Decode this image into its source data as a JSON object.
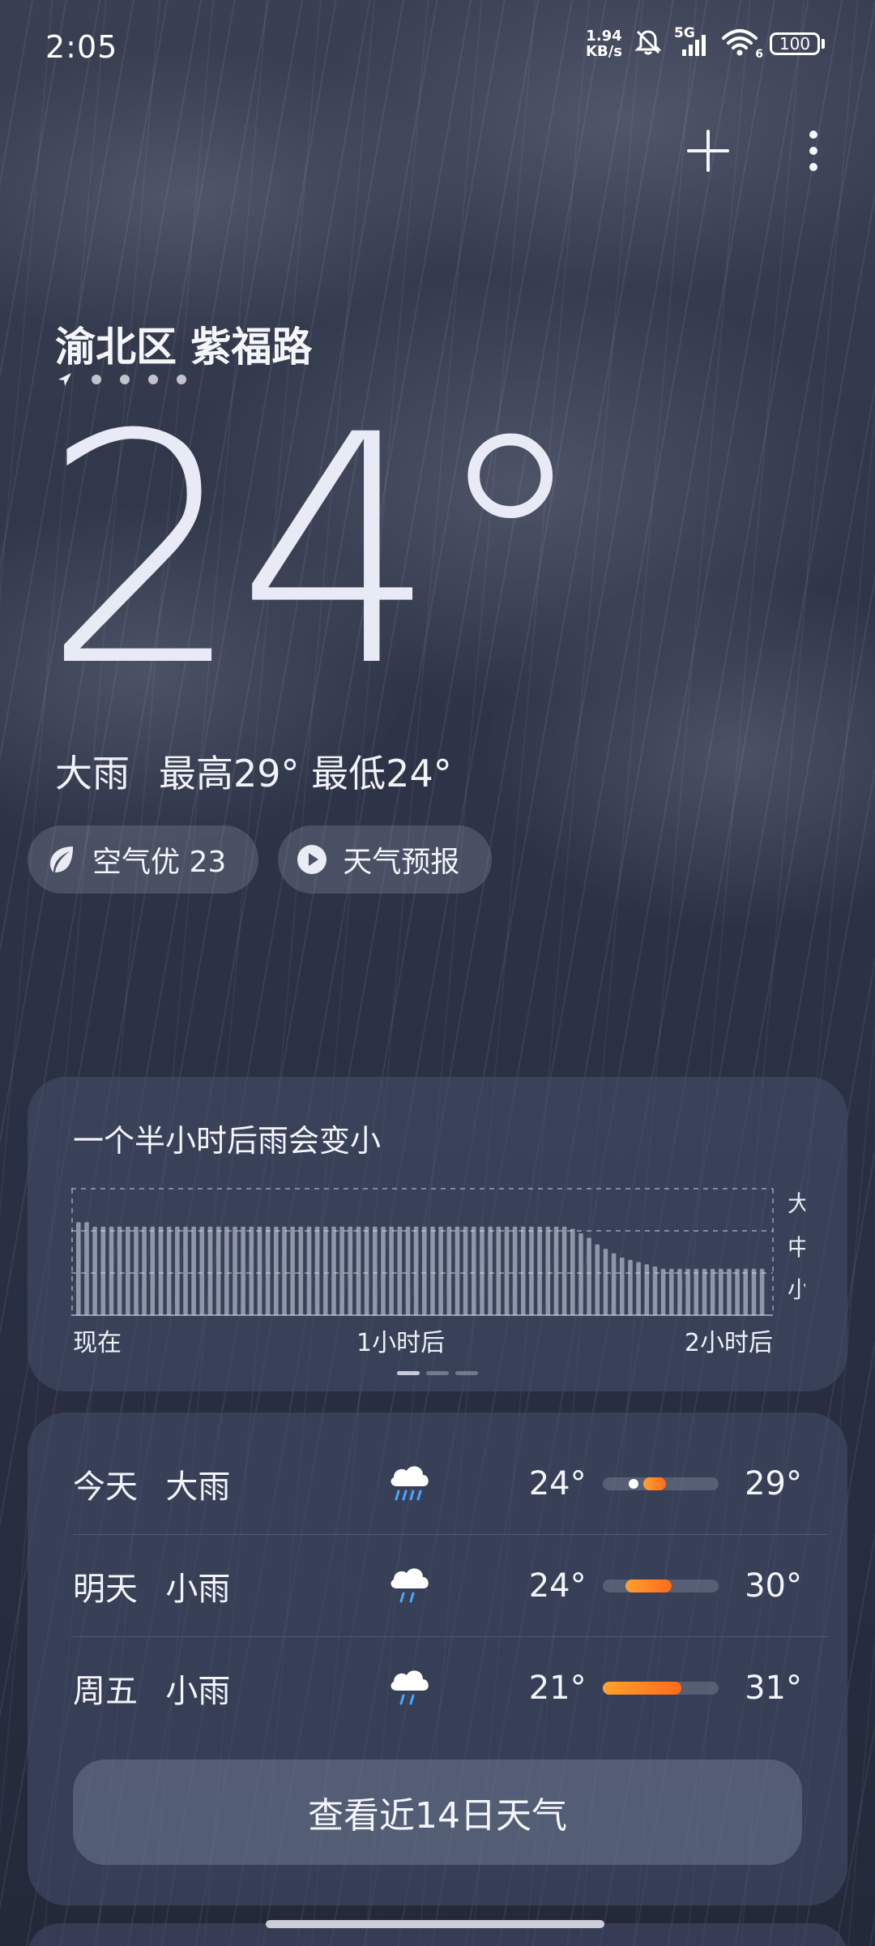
{
  "status_bar": {
    "time": "2:05",
    "net_speed_value": "1.94",
    "net_speed_unit": "KB/s",
    "network_type": "5G",
    "wifi_badge": "6",
    "battery": "100",
    "icons": [
      "mute-bell-icon",
      "signal-icon",
      "wifi-icon",
      "battery-icon"
    ]
  },
  "header": {
    "add_city_icon": "plus-icon",
    "more_icon": "more-vertical-icon"
  },
  "location": {
    "name": "渝北区 紫福路",
    "pages": 5,
    "current_page": 1
  },
  "current": {
    "temperature": "24°",
    "condition": "大雨",
    "high": "最高29°",
    "low": "最低24°"
  },
  "chips": {
    "air_quality": "空气优 23",
    "forecast_video": "天气预报"
  },
  "rain_card": {
    "title": "一个半小时后雨会变小",
    "levels": [
      "大",
      "中",
      "小"
    ],
    "x_labels": [
      "现在",
      "1小时后",
      "2小时后"
    ],
    "pages": 3,
    "active_page": 0
  },
  "chart_data": {
    "type": "bar",
    "title": "一个半小时后雨会变小",
    "xlabel": "",
    "ylabel": "",
    "x_tick_labels": [
      "现在",
      "1小时后",
      "2小时后"
    ],
    "y_tick_labels": [
      "小",
      "中",
      "大"
    ],
    "ylim": [
      0,
      3
    ],
    "values": [
      2.1,
      2.1,
      2.0,
      2.0,
      2.0,
      2.0,
      2.0,
      2.0,
      2.0,
      2.0,
      2.0,
      2.0,
      2.0,
      2.0,
      2.0,
      2.0,
      2.0,
      2.0,
      2.0,
      2.0,
      2.0,
      2.0,
      2.0,
      2.0,
      2.0,
      2.0,
      2.0,
      2.0,
      2.0,
      2.0,
      2.0,
      2.0,
      2.0,
      2.0,
      2.0,
      2.0,
      2.0,
      2.0,
      2.0,
      2.0,
      2.0,
      2.0,
      2.0,
      2.0,
      2.0,
      2.0,
      2.0,
      2.0,
      2.0,
      2.0,
      2.0,
      2.0,
      2.0,
      2.0,
      2.0,
      2.0,
      2.0,
      2.0,
      2.0,
      2.0,
      1.95,
      1.85,
      1.75,
      1.6,
      1.5,
      1.4,
      1.3,
      1.25,
      1.2,
      1.15,
      1.1,
      1.05,
      1.05,
      1.05,
      1.05,
      1.05,
      1.05,
      1.05,
      1.05,
      1.05,
      1.05,
      1.05,
      1.05,
      1.05
    ],
    "grid": true,
    "grid_style": "dashed"
  },
  "forecast": {
    "rows": [
      {
        "day": "今天",
        "condition": "大雨",
        "icon": "heavy-rain-icon",
        "low": "24°",
        "high": "29°",
        "range_start": 0.35,
        "range_end": 0.55,
        "current": 0.27
      },
      {
        "day": "明天",
        "condition": "小雨",
        "icon": "light-rain-icon",
        "low": "24°",
        "high": "30°",
        "range_start": 0.2,
        "range_end": 0.6,
        "current": null
      },
      {
        "day": "周五",
        "condition": "小雨",
        "icon": "light-rain-icon",
        "low": "21°",
        "high": "31°",
        "range_start": 0.0,
        "range_end": 0.68,
        "current": null
      }
    ],
    "button": "查看近14日天气"
  },
  "colors": {
    "accent_orange": "#ff7a22",
    "accent_orange_light": "#ffa12c",
    "rain_blue": "#4aa8ff"
  }
}
